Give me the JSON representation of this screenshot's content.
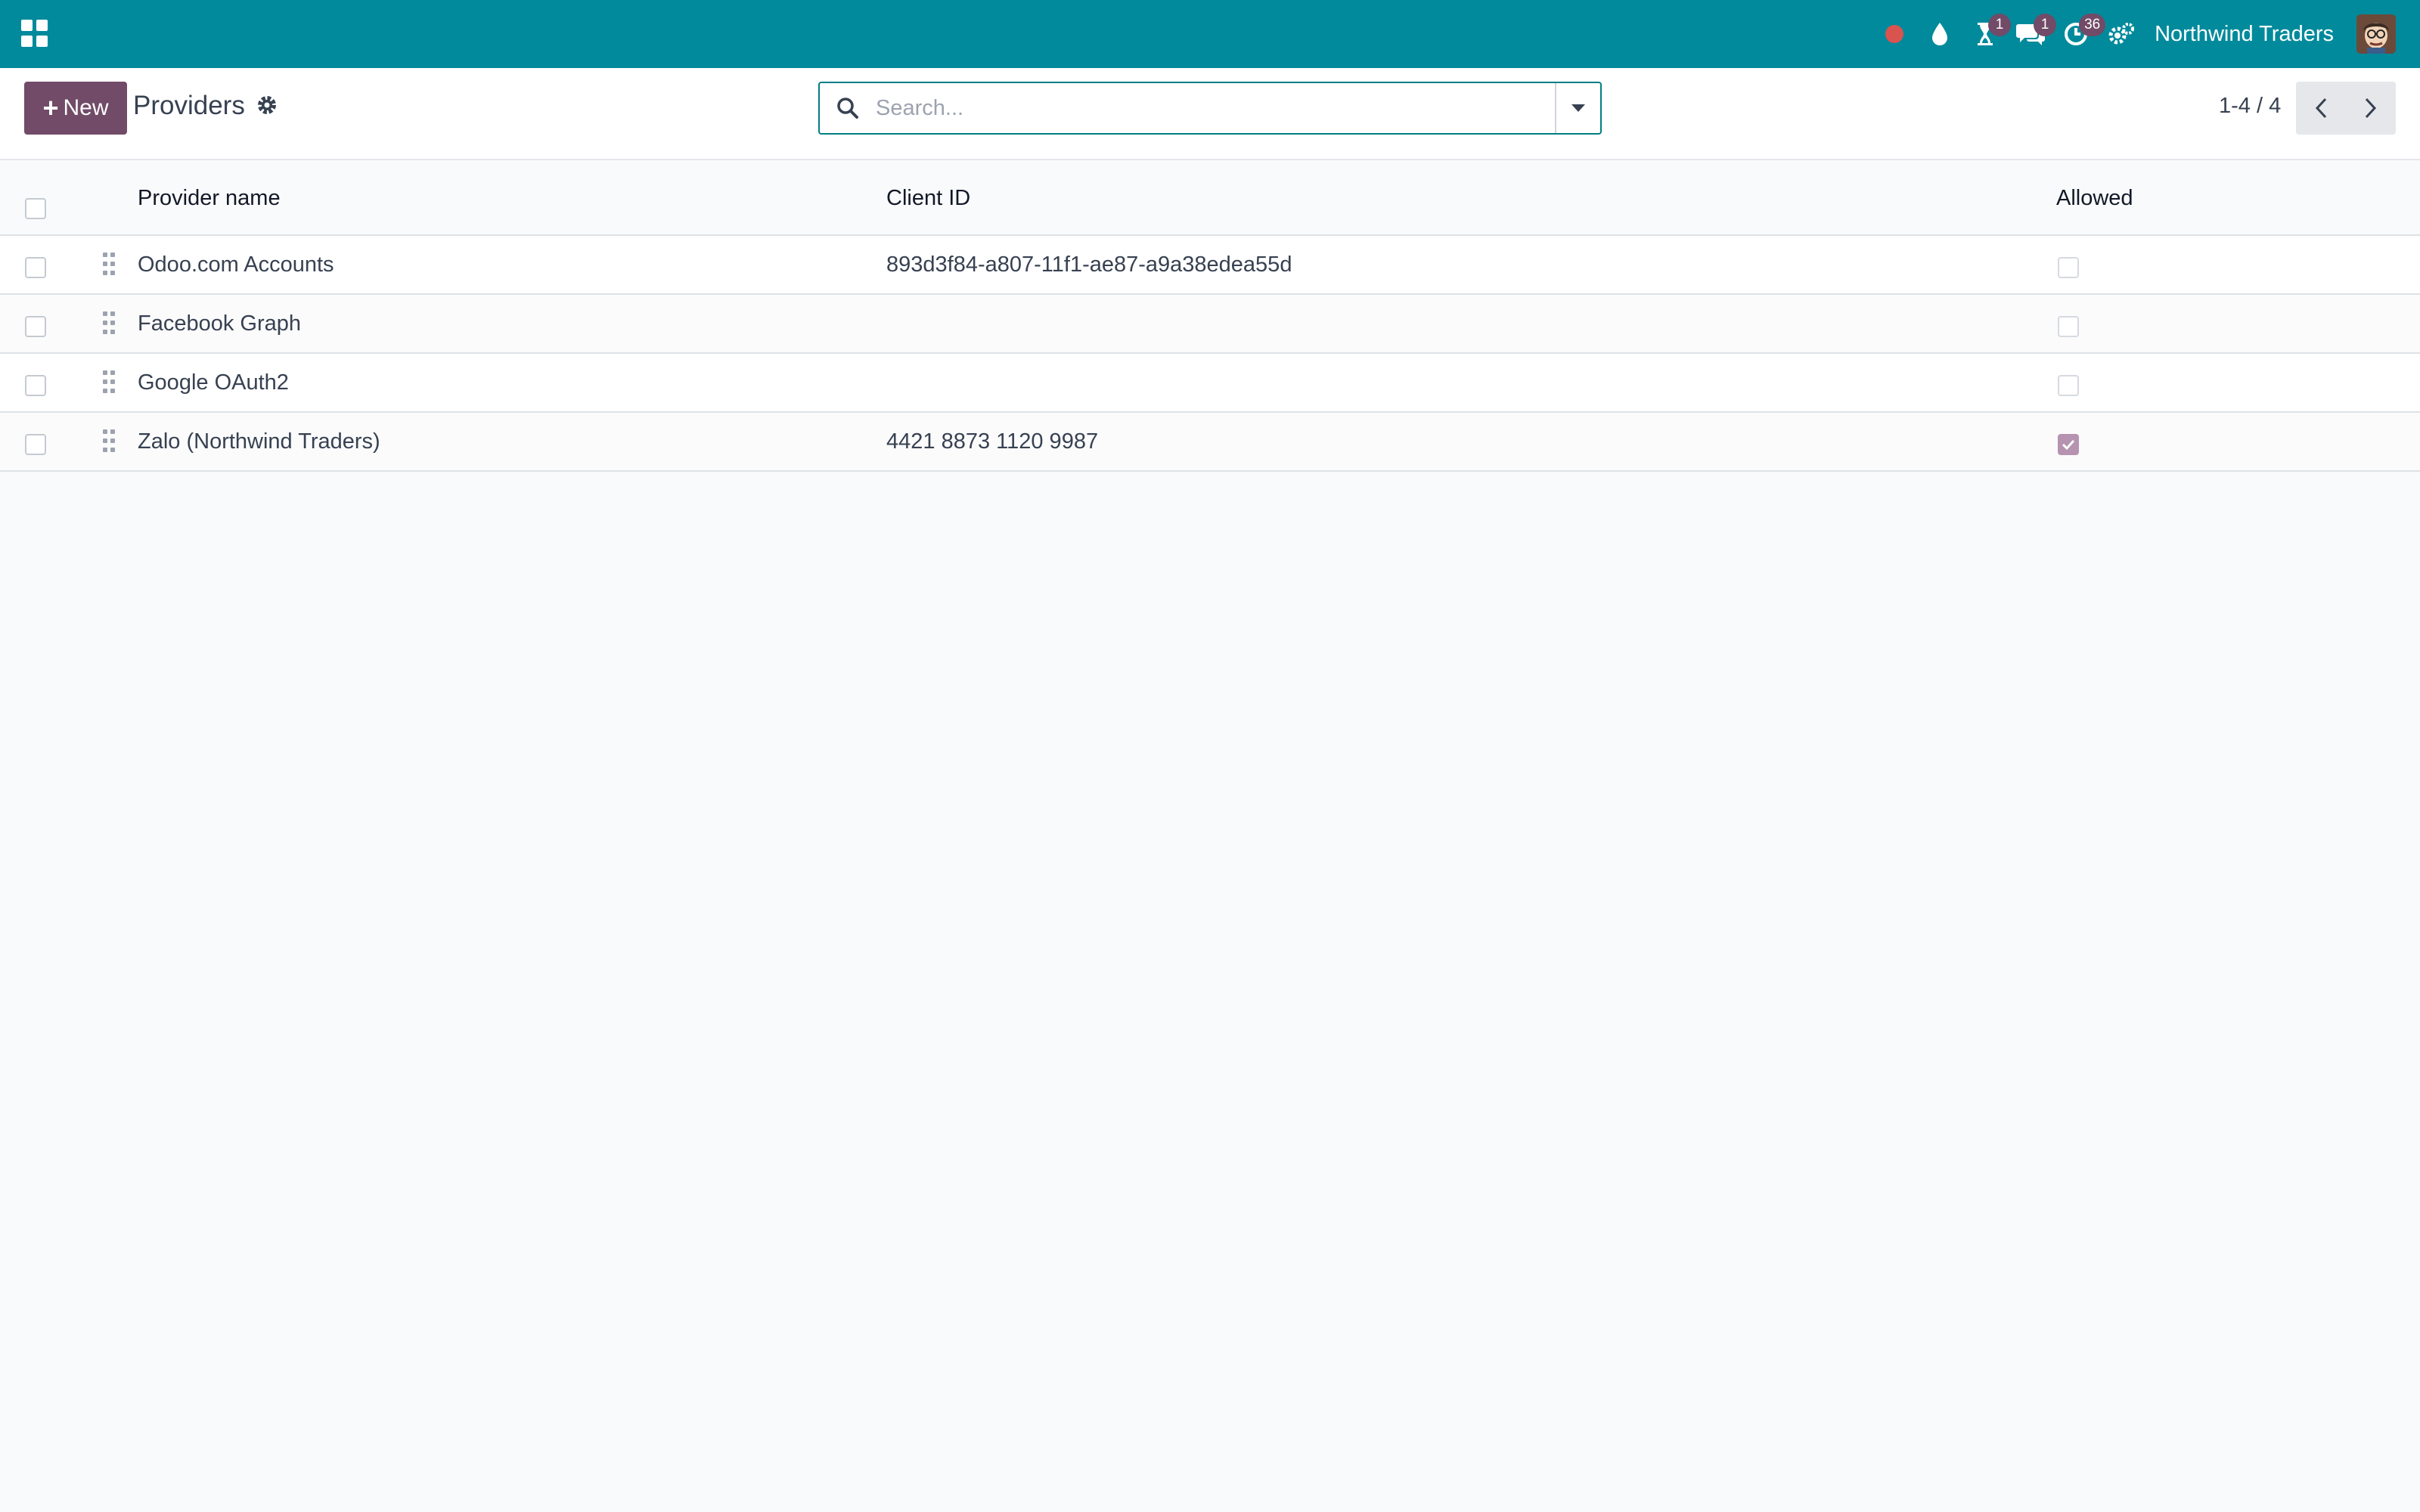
{
  "navbar": {
    "company": "Northwind Traders",
    "badges": {
      "activity_1": "1",
      "messages": "1",
      "clock": "36"
    },
    "colors": {
      "navbar_bg": "#018a9c",
      "badge_bg": "#714b67",
      "record_dot": "#d9534f"
    }
  },
  "control_panel": {
    "new_label": "New",
    "title": "Providers",
    "search_placeholder": "Search...",
    "pager": "1-4 / 4"
  },
  "table": {
    "headers": {
      "name": "Provider name",
      "client_id": "Client ID",
      "allowed": "Allowed"
    },
    "rows": [
      {
        "name": "Odoo.com Accounts",
        "client_id": "893d3f84-a807-11f1-ae87-a9a38edea55d",
        "allowed": false
      },
      {
        "name": "Facebook Graph",
        "client_id": "",
        "allowed": false
      },
      {
        "name": "Google OAuth2",
        "client_id": "",
        "allowed": false
      },
      {
        "name": "Zalo (Northwind Traders)",
        "client_id": "4421 8873 1120 9987",
        "allowed": true
      }
    ]
  }
}
